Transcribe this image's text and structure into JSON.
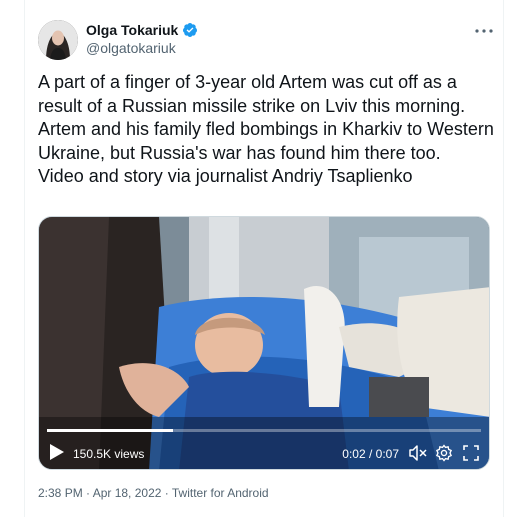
{
  "author": {
    "name": "Olga Tokariuk",
    "handle": "@olgatokariuk",
    "verified": true
  },
  "tweet": {
    "text": "A part of a finger of 3-year old Artem was cut off as a result of a Russian missile strike on Lviv this morning. Artem and his family fled bombings in Kharkiv to Western Ukraine, but Russia's war has found him there too.\nVideo and story via journalist Andriy Tsaplienko"
  },
  "video": {
    "views": "150.5K views",
    "time": "0:02 / 0:07",
    "progress": 0.29
  },
  "meta": {
    "timestamp": "2:38 PM · Apr 18, 2022 · Twitter for Android"
  },
  "icons": {
    "more": "more-icon",
    "verified": "verified-badge-icon",
    "play": "play-icon",
    "mute": "mute-icon",
    "settings": "gear-icon",
    "fullscreen": "fullscreen-icon"
  },
  "colors": {
    "text": "#0f1419",
    "secondary": "#536471",
    "verified": "#1d9bf0"
  }
}
